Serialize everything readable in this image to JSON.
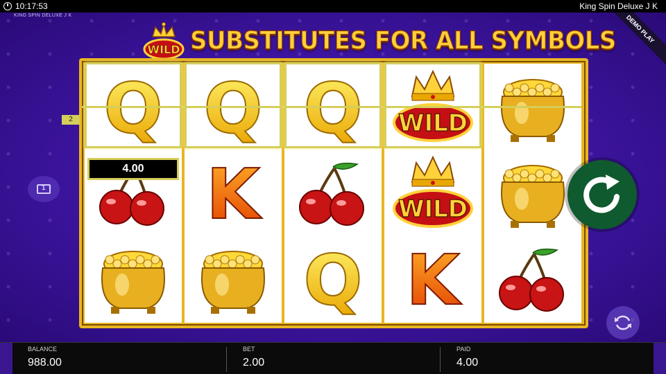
{
  "status_bar": {
    "time": "10:17:53",
    "app_title": "King Spin Deluxe J K"
  },
  "game": {
    "subtitle": "KING SPIN DELUXE J K",
    "banner_text": "SUBSTITUTES FOR ALL SYMBOLS",
    "banner_badge": "WILD",
    "demo_label": "DEMO PLAY",
    "payline_number": "2",
    "win_amount": "4.00",
    "reels": [
      [
        "Q",
        "cherry",
        "pot"
      ],
      [
        "Q",
        "K",
        "pot"
      ],
      [
        "Q",
        "cherry",
        "Q"
      ],
      [
        "WILD",
        "WILD",
        "K"
      ],
      [
        "pot",
        "pot",
        "cherry"
      ]
    ],
    "wild_label": "WILD"
  },
  "colors": {
    "background": "#3f16a5",
    "frame": "#e8b622",
    "highlight": "#d4ce5a",
    "spin": "#0f5a2e"
  },
  "bottom_bar": {
    "balance_label": "BALANCE",
    "balance_value": "988.00",
    "bet_label": "BET",
    "bet_value": "2.00",
    "paid_label": "PAID",
    "paid_value": "4.00"
  },
  "icons": {
    "cash": "banknote-icon",
    "spin": "spin-arrow-icon",
    "autoplay": "autoplay-icon",
    "clock": "clock-icon"
  }
}
